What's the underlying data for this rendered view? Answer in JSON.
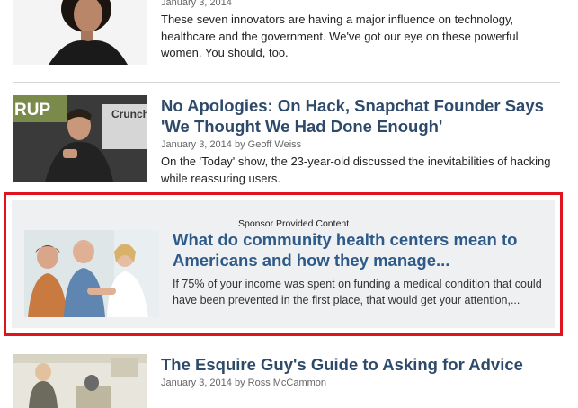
{
  "articles": [
    {
      "date": "January 3, 2014",
      "summary": "These seven innovators are having a major influence on technology, healthcare and the government. We've got our eye on these powerful women. You should, too."
    },
    {
      "title": "No Apologies: On Hack, Snapchat Founder Says 'We Thought We Had Done Enough'",
      "date_prefix": "January 3, 2014 by",
      "author": "Geoff Weiss",
      "summary": "On the 'Today' show, the 23-year-old discussed the inevitabilities of hacking while reassuring users.",
      "thumb_text_1": "RUP",
      "thumb_text_2": "Crunch"
    }
  ],
  "sponsored": {
    "label": "Sponsor Provided Content",
    "title": "What do community health centers mean to Americans and how they manage...",
    "summary": "If 75% of your income was spent on funding a medical condition that could have been prevented in the first place, that would get your attention,..."
  },
  "last_article": {
    "title": "The Esquire Guy's Guide to Asking for Advice",
    "date_prefix": "January 3, 2014 by",
    "author": "Ross McCammon"
  },
  "colors": {
    "title": "#2e4a6b",
    "highlight_border": "#e0141e",
    "sponsor_bg": "#eef0f2"
  }
}
